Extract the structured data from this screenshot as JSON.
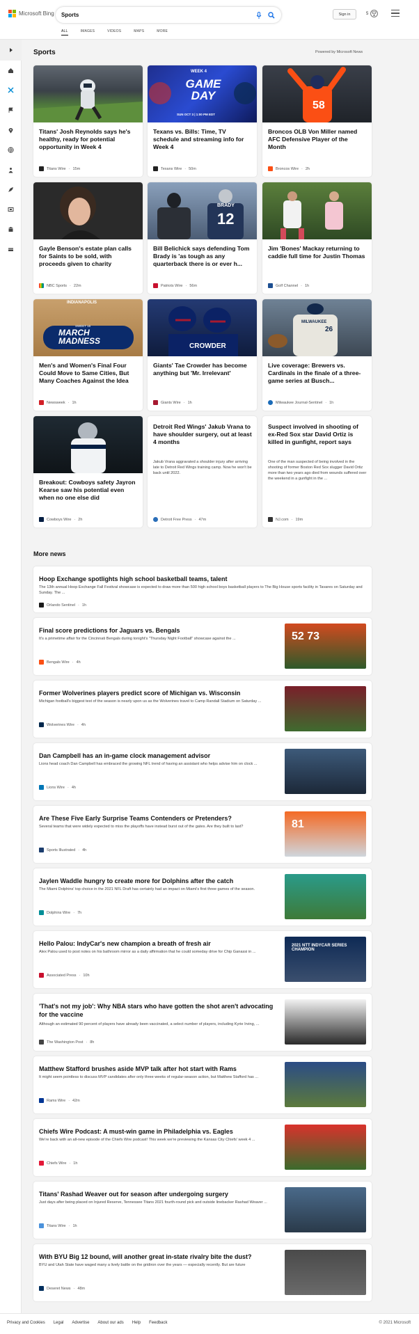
{
  "header": {
    "logo_text": "Microsoft Bing",
    "search_value": "Sports",
    "tabs": [
      "ALL",
      "IMAGES",
      "VIDEOS",
      "MAPS",
      "MORE"
    ],
    "signin": "Sign in",
    "rewards": "5"
  },
  "section": {
    "title": "Sports",
    "powered": "Powered by Microsoft News"
  },
  "cards": [
    {
      "title": "Titans' Josh Reynolds says he's healthy, ready for potential opportunity in Week 4",
      "source": "Titans Wire",
      "time": "15m",
      "desc": ""
    },
    {
      "title": "Texans vs. Bills: Time, TV schedule and streaming info for Week 4",
      "source": "Texans Wire",
      "time": "50m",
      "desc": "",
      "img_text": {
        "week": "WEEK 4",
        "game": "GAME",
        "day": "DAY",
        "when": "SUN OCT 3 | 1:00 PM EDT"
      }
    },
    {
      "title": "Broncos OLB Von Miller named AFC Defensive Player of the Month",
      "source": "Broncos Wire",
      "time": "2h",
      "desc": ""
    },
    {
      "title": "Gayle Benson's estate plan calls for Saints to be sold, with proceeds given to charity",
      "source": "NBC Sports",
      "time": "22m",
      "desc": ""
    },
    {
      "title": "Bill Belichick says defending Tom Brady is 'as tough as any quarterback there is or ever h...",
      "source": "Patriots Wire",
      "time": "56m",
      "desc": "",
      "img_text": {
        "name": "BRADY",
        "num": "12"
      }
    },
    {
      "title": "Jim 'Bones' Mackay returning to caddie full time for Justin Thomas",
      "source": "Golf Channel",
      "time": "1h",
      "desc": ""
    },
    {
      "title": "Men's and Women's Final Four Could Move to Same Cities, But Many Coaches Against the Idea",
      "source": "Newsweek",
      "time": "1h",
      "desc": "",
      "img_text": {
        "city": "INDIANAPOLIS",
        "march": "MARCH",
        "madness": "MADNESS",
        "sweet": "SWEET 16"
      }
    },
    {
      "title": "Giants' Tae Crowder has become anything but 'Mr. Irrelevant'",
      "source": "Giants Wire",
      "time": "1h",
      "desc": "",
      "img_text": {
        "name": "CROWDER"
      }
    },
    {
      "title": "Live coverage: Brewers vs. Cardinals in the finale of a three-game series at Busch...",
      "source": "Milwaukee Journal-Sentinel",
      "time": "1h",
      "desc": "",
      "img_text": {
        "jersey": "MILWAUKEE",
        "num": "26"
      }
    },
    {
      "title": "Breakout: Cowboys safety Jayron Kearse saw his potential even when no one else did",
      "source": "Cowboys Wire",
      "time": "2h",
      "desc": ""
    },
    {
      "title": "Detroit Red Wings' Jakub Vrana to have shoulder surgery, out at least 4 months",
      "source": "Detroit Free Press",
      "time": "47m",
      "desc": "Jakub Vrana aggravated a shoulder injury after arriving late to Detroit Red Wings training camp. Now he won't be back until 2022."
    },
    {
      "title": "Suspect involved in shooting of ex-Red Sox star David Ortiz is killed in gunfight, report says",
      "source": "NJ.com",
      "time": "19m",
      "desc": "One of the man suspected of being involved in the shooting of former Boston Red Sox slugger David Ortiz more than two years ago died from wounds suffered over the weekend in a gunfight in the ..."
    }
  ],
  "more_title": "More news",
  "news": [
    {
      "title": "Hoop Exchange spotlights high school basketball teams, talent",
      "desc": "The 13th annual Hoop Exchange Fall Festival showcase is expected to draw more than 500 high school boys basketball players to The Big House sports facility in Tavares on Saturday and Sunday. The ...",
      "source": "Orlando Sentinel",
      "time": "1h"
    },
    {
      "title": "Final score predictions for Jaguars vs. Bengals",
      "desc": "It's a primetime affair for the Cincinnati Bengals during tonight's \"Thursday Night Football\" showcase against the ...",
      "source": "Bengals Wire",
      "time": "4h"
    },
    {
      "title": "Former Wolverines players predict score of Michigan vs. Wisconsin",
      "desc": "Michigan football's biggest test of the season is nearly upon us as the Wolverines travel to Camp Randall Stadium on Saturday ...",
      "source": "Wolverines Wire",
      "time": "4h"
    },
    {
      "title": "Dan Campbell has an in-game clock management advisor",
      "desc": "Lions head coach Dan Campbell has embraced the growing NFL trend of having an assistant who helps advise him on clock ...",
      "source": "Lions Wire",
      "time": "4h"
    },
    {
      "title": "Are These Five Early Surprise Teams Contenders or Pretenders?",
      "desc": "Several teams that were widely expected to miss the playoffs have instead burst out of the gates. Are they built to last?",
      "source": "Sports Illustrated",
      "time": "4h"
    },
    {
      "title": "Jaylen Waddle hungry to create more for Dolphins after the catch",
      "desc": "The Miami Dolphins' top choice in the 2021 NFL Draft has certainly had an impact on Miami's first three games of the season.",
      "source": "Dolphins Wire",
      "time": "7h"
    },
    {
      "title": "Hello Palou: IndyCar's new champion a breath of fresh air",
      "desc": "Alex Palou used to post notes on his bathroom mirror as a daily affirmation that he could someday drive for Chip Ganassi in ...",
      "source": "Associated Press",
      "time": "10h"
    },
    {
      "title": "'That's not my job': Why NBA stars who have gotten the shot aren't advocating for the vaccine",
      "desc": "Although an estimated 90 percent of players have already been vaccinated, a select number of players, including Kyrie Irving, ...",
      "source": "The Washington Post",
      "time": "8h"
    },
    {
      "title": "Matthew Stafford brushes aside MVP talk after hot start with Rams",
      "desc": "It might seem pointless to discuss MVP candidates after only three weeks of regular-season action, but Matthew Stafford has ...",
      "source": "Rams Wire",
      "time": "42m"
    },
    {
      "title": "Chiefs Wire Podcast: A must-win game in Philadelphia vs. Eagles",
      "desc": "We're back with an all-new episode of the Chiefs Wire podcast! This week we're previewing the Kansas City Chiefs' week 4 ...",
      "source": "Chiefs Wire",
      "time": "1h"
    },
    {
      "title": "Titans' Rashad Weaver out for season after undergoing surgery",
      "desc": "Just days after being placed on Injured Reserve, Tennessee Titans 2021 fourth-round pick and outside linebacker Rashad Weaver ...",
      "source": "Titans Wire",
      "time": "1h"
    },
    {
      "title": "With BYU Big 12 bound, will another great in-state rivalry bite the dust?",
      "desc": "BYU and Utah State have waged many a lively battle on the gridiron over the years — especially recently. But are future",
      "source": "Deseret News",
      "time": "48m"
    }
  ],
  "thumb_text": {
    "bengals": "52 73",
    "broncos": "81",
    "indycar": "2021 NTT INDYCAR SERIES CHAMPION"
  },
  "footer": {
    "links": [
      "Privacy and Cookies",
      "Legal",
      "Advertise",
      "About our ads",
      "Help",
      "Feedback"
    ],
    "copyright": "© 2021 Microsoft"
  }
}
